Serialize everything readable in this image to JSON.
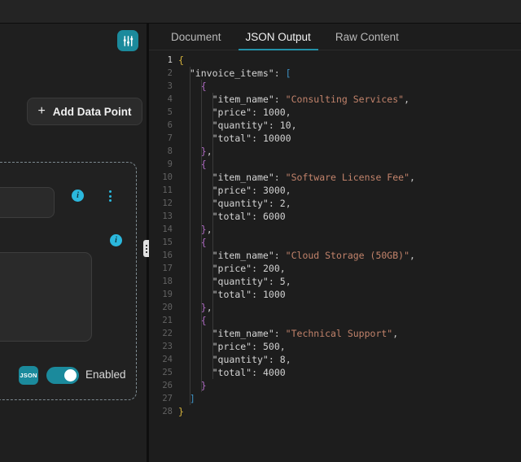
{
  "window": {
    "background": "#1c1c1c"
  },
  "left_panel": {
    "filter_button": {
      "icon": "sliders-icon",
      "color": "#1b8a9c"
    },
    "add_button": {
      "label": "Add Data Point",
      "icon": "plus-icon"
    },
    "info_icon_label": "i",
    "kebab_label": "more-options",
    "json_badge": {
      "label": "JSON",
      "color": "#1b8a9c"
    },
    "toggle": {
      "state": "on",
      "label": "Enabled",
      "color": "#1b8a9c"
    }
  },
  "splitter": {
    "handle_icon": "drag-handle-icon"
  },
  "right_panel": {
    "tabs": [
      {
        "label": "Document",
        "active": false
      },
      {
        "label": "JSON Output",
        "active": true
      },
      {
        "label": "Raw Content",
        "active": false
      }
    ],
    "active_tab_underline_color": "#2391a8"
  },
  "json_output": {
    "line_numbers": [
      1,
      2,
      3,
      4,
      5,
      6,
      7,
      8,
      9,
      10,
      11,
      12,
      13,
      14,
      15,
      16,
      17,
      18,
      19,
      20,
      21,
      22,
      23,
      24,
      25,
      26,
      27,
      28
    ],
    "root_key": "invoice_items",
    "invoice_items": [
      {
        "item_name": "Consulting Services",
        "price": 1000,
        "quantity": 10,
        "total": 10000
      },
      {
        "item_name": "Software License Fee",
        "price": 3000,
        "quantity": 2,
        "total": 6000
      },
      {
        "item_name": "Cloud Storage (50GB)",
        "price": 200,
        "quantity": 5,
        "total": 1000
      },
      {
        "item_name": "Technical Support",
        "price": 500,
        "quantity": 8,
        "total": 4000
      }
    ],
    "lines": [
      "{",
      "  \"invoice_items\": [",
      "    {",
      "      \"item_name\": \"Consulting Services\",",
      "      \"price\": 1000,",
      "      \"quantity\": 10,",
      "      \"total\": 10000",
      "    },",
      "    {",
      "      \"item_name\": \"Software License Fee\",",
      "      \"price\": 3000,",
      "      \"quantity\": 2,",
      "      \"total\": 6000",
      "    },",
      "    {",
      "      \"item_name\": \"Cloud Storage (50GB)\",",
      "      \"price\": 200,",
      "      \"quantity\": 5,",
      "      \"total\": 1000",
      "    },",
      "    {",
      "      \"item_name\": \"Technical Support\",",
      "      \"price\": 500,",
      "      \"quantity\": 8,",
      "      \"total\": 4000",
      "    }",
      "  ]",
      "}"
    ],
    "colors": {
      "key": "#d4d4d4",
      "string": "#c2836b",
      "number": "#d2d2d2",
      "bracket_depth_1": "#d6b33c",
      "bracket_depth_2": "#3e92c4",
      "background": "#1d1d1d"
    }
  }
}
